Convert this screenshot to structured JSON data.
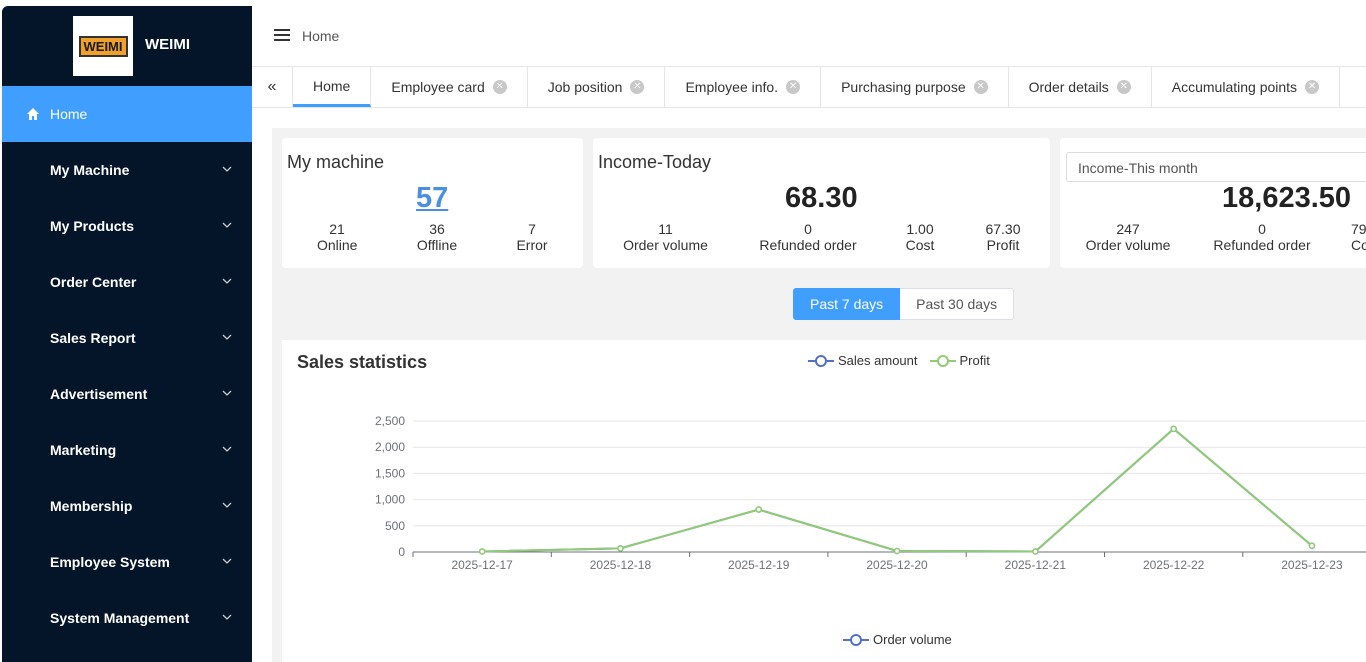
{
  "brand": {
    "logo_text": "WEIMI",
    "name": "WEIMI"
  },
  "sidebar": {
    "items": [
      {
        "label": "Home",
        "icon": "home-icon",
        "active": true
      },
      {
        "label": "My Machine",
        "icon": "grid-icon"
      },
      {
        "label": "My Products",
        "icon": "grid-icon"
      },
      {
        "label": "Order Center",
        "icon": "grid-icon"
      },
      {
        "label": "Sales Report",
        "icon": "grid-icon"
      },
      {
        "label": "Advertisement",
        "icon": "grid-icon"
      },
      {
        "label": "Marketing",
        "icon": "grid-icon"
      },
      {
        "label": "Membership",
        "icon": "grid-icon"
      },
      {
        "label": "Employee System",
        "icon": "grid-icon"
      },
      {
        "label": "System Management",
        "icon": "grid-icon"
      }
    ]
  },
  "header": {
    "breadcrumb": "Home"
  },
  "tabs": [
    {
      "label": "Home",
      "active": true
    },
    {
      "label": "Employee card"
    },
    {
      "label": "Job position"
    },
    {
      "label": "Employee info."
    },
    {
      "label": "Purchasing purpose"
    },
    {
      "label": "Order details"
    },
    {
      "label": "Accumulating points"
    }
  ],
  "my_machine": {
    "title": "My machine",
    "total": "57",
    "online_value": "21",
    "online_label": "Online",
    "offline_value": "36",
    "offline_label": "Offline",
    "error_value": "7",
    "error_label": "Error"
  },
  "income_today": {
    "title": "Income-Today",
    "total": "68.30",
    "order_volume_value": "11",
    "order_volume_label": "Order volume",
    "refunded_value": "0",
    "refunded_label": "Refunded order",
    "cost_value": "1.00",
    "cost_label": "Cost",
    "profit_value": "67.30",
    "profit_label": "Profit"
  },
  "income_month": {
    "select_value": "Income-This month",
    "total": "18,623.50",
    "order_volume_value": "247",
    "order_volume_label": "Order volume",
    "refunded_value": "0",
    "refunded_label": "Refunded order",
    "cost_value_partial": "79",
    "cost_label_partial": "Co"
  },
  "range_buttons": {
    "past7": "Past 7 days",
    "past30": "Past 30 days"
  },
  "colors": {
    "accent": "#409eff",
    "sidebar_bg": "#04152a",
    "sales_series": "#5470c6",
    "profit_series": "#91cc75"
  },
  "chart_data": {
    "type": "line",
    "title": "Sales statistics",
    "categories": [
      "2025-12-17",
      "2025-12-18",
      "2025-12-19",
      "2025-12-20",
      "2025-12-21",
      "2025-12-22",
      "2025-12-23"
    ],
    "series": [
      {
        "name": "Sales amount",
        "values": [
          10,
          70,
          810,
          20,
          10,
          2350,
          120
        ]
      },
      {
        "name": "Profit",
        "values": [
          10,
          70,
          810,
          20,
          10,
          2350,
          120
        ]
      }
    ],
    "yticks": [
      "0",
      "500",
      "1,000",
      "1,500",
      "2,000",
      "2,500"
    ],
    "ylim": [
      0,
      2500
    ],
    "grid": true,
    "legend_position": "top-center"
  },
  "second_chart_legend": "Order volume"
}
